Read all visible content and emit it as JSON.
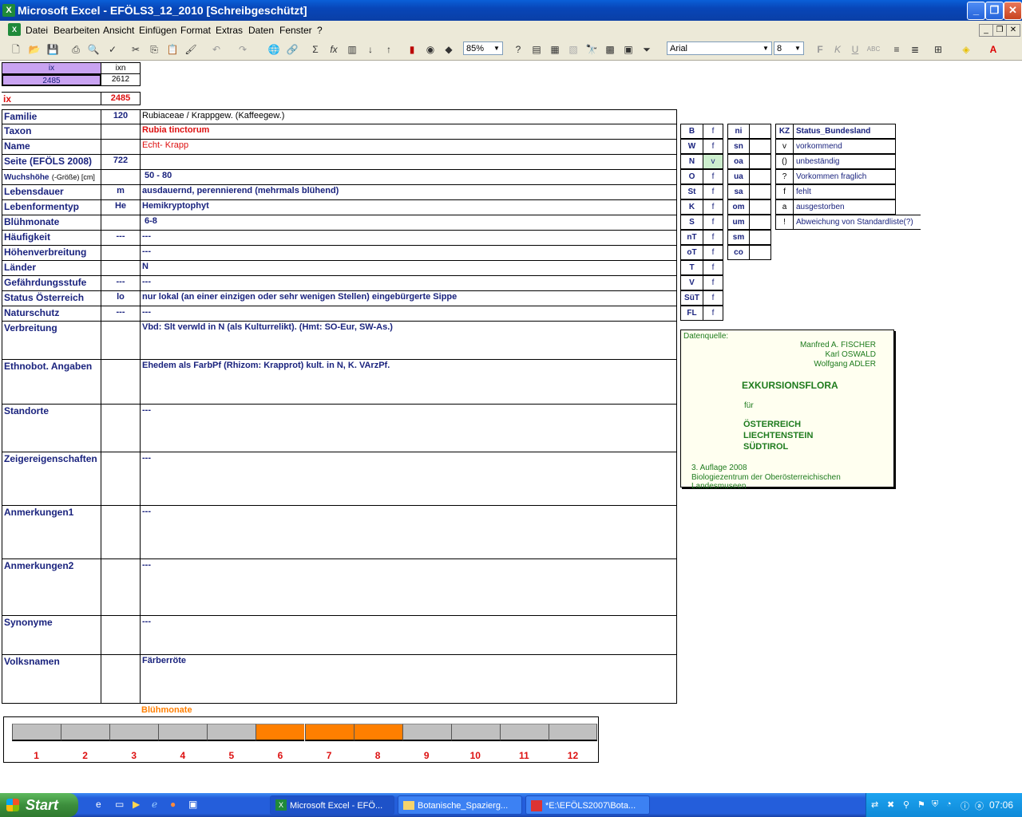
{
  "window": {
    "title": "Microsoft Excel - EFÖLS3_12_2010  [Schreibgeschützt]"
  },
  "menu": [
    "Datei",
    "Bearbeiten",
    "Ansicht",
    "Einfügen",
    "Format",
    "Extras",
    "Daten",
    "Fenster",
    "?"
  ],
  "toolbar": {
    "zoom": "85%",
    "font": "Arial",
    "size": "8"
  },
  "index": {
    "ix_head": "ix",
    "ixn_head": "ixn",
    "ix_val": "2485",
    "ixn_val": "2612",
    "ix_label": "ix",
    "ix_value": "2485"
  },
  "rows": [
    {
      "label": "Familie",
      "code": "120",
      "value": "Rubiaceae  /  Krappgew. (Kaffeegew.)"
    },
    {
      "label": "Taxon",
      "code": "",
      "value": "Rubia tinctorum"
    },
    {
      "label": "Name",
      "code": "",
      "value": "Echt- Krapp"
    },
    {
      "label": "Seite (EFÖLS 2008)",
      "code": "722",
      "value": ""
    },
    {
      "label": "Wuchshöhe",
      "label_suffix": "(-Größe) [cm]",
      "code": "",
      "value": "50 - 80"
    },
    {
      "label": "Lebensdauer",
      "code": "m",
      "value": "ausdauernd, perennierend (mehrmals blühend)"
    },
    {
      "label": "Lebenformentyp",
      "code": "He",
      "value": "Hemikryptophyt"
    },
    {
      "label": "Blühmonate",
      "code": "",
      "value": "6-8"
    },
    {
      "label": "Häufigkeit",
      "code": "---",
      "value": "---"
    },
    {
      "label": "Höhenverbreitung",
      "code": "",
      "value": "---"
    },
    {
      "label": "Länder",
      "code": "",
      "value": "N"
    },
    {
      "label": "Gefährdungsstufe",
      "code": "---",
      "value": "---"
    },
    {
      "label": "Status Österreich",
      "code": "lo",
      "value": "nur lokal (an einer einzigen oder sehr wenigen Stellen) eingebürgerte Sippe"
    },
    {
      "label": "Naturschutz",
      "code": "---",
      "value": "---"
    }
  ],
  "tall_rows": [
    {
      "label": "Verbreitung",
      "value": "Vbd: Slt verwld in N (als Kulturrelikt). (Hmt: SO-Eur, SW-As.)"
    },
    {
      "label": "Ethnobot. Angaben",
      "value": "Ehedem als FarbPf (Rhizom: Krapprot) kult. in N, K.  VArzPf."
    },
    {
      "label": "Standorte",
      "value": "---"
    },
    {
      "label": "Zeigereigenschaften",
      "value": "---"
    },
    {
      "label": "Anmerkungen1",
      "value": "---"
    },
    {
      "label": "Anmerkungen2",
      "value": "---"
    },
    {
      "label": "Synonyme",
      "value": "---"
    },
    {
      "label": "Volksnamen",
      "value": "Färberröte"
    }
  ],
  "states": [
    {
      "k": "B",
      "v": "f"
    },
    {
      "k": "W",
      "v": "f"
    },
    {
      "k": "N",
      "v": "v"
    },
    {
      "k": "O",
      "v": "f"
    },
    {
      "k": "St",
      "v": "f"
    },
    {
      "k": "K",
      "v": "f"
    },
    {
      "k": "S",
      "v": "f"
    },
    {
      "k": "nT",
      "v": "f"
    },
    {
      "k": "oT",
      "v": "f"
    },
    {
      "k": "T",
      "v": "f"
    },
    {
      "k": "V",
      "v": "f"
    },
    {
      "k": "SüT",
      "v": "f"
    },
    {
      "k": "FL",
      "v": "f"
    }
  ],
  "regions": [
    {
      "k": "ni",
      "v": ""
    },
    {
      "k": "sn",
      "v": ""
    },
    {
      "k": "oa",
      "v": ""
    },
    {
      "k": "ua",
      "v": ""
    },
    {
      "k": "sa",
      "v": ""
    },
    {
      "k": "om",
      "v": ""
    },
    {
      "k": "um",
      "v": ""
    },
    {
      "k": "sm",
      "v": ""
    },
    {
      "k": "co",
      "v": ""
    }
  ],
  "legend": {
    "head_k": "KZ",
    "head_v": "Status_Bundesland",
    "items": [
      {
        "k": "v",
        "v": "vorkommend"
      },
      {
        "k": "()",
        "v": "unbeständig"
      },
      {
        "k": "?",
        "v": "Vorkommen fraglich"
      },
      {
        "k": "f",
        "v": "fehlt"
      },
      {
        "k": "a",
        "v": "ausgestorben"
      },
      {
        "k": "!",
        "v": "Abweichung von Standardliste(?)"
      }
    ]
  },
  "source": {
    "label": "Datenquelle:",
    "authors": [
      "Manfred A. FISCHER",
      "Karl OSWALD",
      "Wolfgang ADLER"
    ],
    "title": "EXKURSIONSFLORA",
    "fuer": "für",
    "countries": [
      "ÖSTERREICH",
      "LIECHTENSTEIN",
      "SÜDTIROL"
    ],
    "edition": "3. Auflage 2008",
    "publisher": "Biologiezentrum der Oberösterreichischen Landesmuseen"
  },
  "bloom": {
    "title": "Blühmonate",
    "months": [
      "1",
      "2",
      "3",
      "4",
      "5",
      "6",
      "7",
      "8",
      "9",
      "10",
      "11",
      "12"
    ],
    "active": [
      6,
      7,
      8
    ],
    "active_color": "#ff7f00",
    "inactive_color": "#c0c0c0"
  },
  "taskbar": {
    "start": "Start",
    "tasks": [
      "Microsoft Excel - EFÖ...",
      "Botanische_Spazierg...",
      "*E:\\EFÖLS2007\\Bota..."
    ],
    "time": "07:06"
  }
}
